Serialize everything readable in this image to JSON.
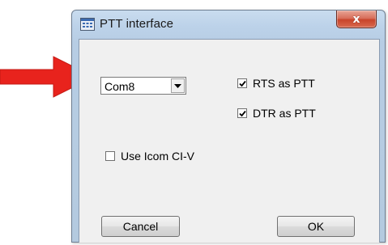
{
  "window": {
    "title": "PTT interface",
    "close_symbol": "x"
  },
  "port": {
    "selected": "Com8"
  },
  "checkboxes": [
    {
      "label": "RTS as PTT",
      "checked": true
    },
    {
      "label": "DTR as PTT",
      "checked": true
    },
    {
      "label": "Use Icom CI-V",
      "checked": false
    }
  ],
  "buttons": {
    "cancel": "Cancel",
    "ok": "OK"
  },
  "icons": {
    "app": "app-window-icon",
    "close": "close-icon",
    "dropdown": "chevron-down-icon",
    "annotation": "red-arrow-icon"
  },
  "colors": {
    "arrow": "#e8231d",
    "titlebar": "#bcd2e9",
    "close_button": "#c8442b",
    "client_bg": "#f0f0f0"
  }
}
